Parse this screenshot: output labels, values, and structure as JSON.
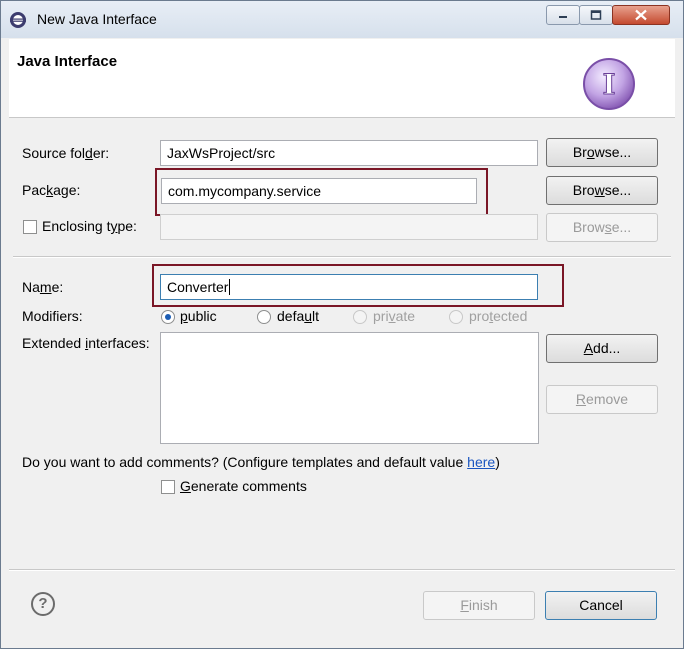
{
  "window": {
    "title": "New Java Interface",
    "minimize_icon": "minimize-icon",
    "maximize_icon": "maximize-icon",
    "close_icon": "close-icon"
  },
  "header": {
    "title": "Java Interface",
    "logo_icon": "interface-I-icon",
    "logo_letter": "I"
  },
  "form": {
    "source_folder": {
      "label": "Source folder:",
      "value": "JaxWsProject/src",
      "button": "Browse..."
    },
    "package": {
      "label": "Package:",
      "value": "com.mycompany.service",
      "button": "Browse..."
    },
    "enclosing": {
      "label": "Enclosing type:",
      "value": "",
      "button": "Browse...",
      "checked": false
    },
    "name": {
      "label": "Name:",
      "value": "Converter"
    },
    "modifiers": {
      "label": "Modifiers:",
      "options": [
        {
          "label": "public",
          "selected": true,
          "enabled": true
        },
        {
          "label": "default",
          "selected": false,
          "enabled": true
        },
        {
          "label": "private",
          "selected": false,
          "enabled": false
        },
        {
          "label": "protected",
          "selected": false,
          "enabled": false
        }
      ]
    },
    "extended": {
      "label": "Extended interfaces:",
      "add": "Add...",
      "remove": "Remove"
    },
    "comments": {
      "prompt": "Do you want to add comments? (Configure templates and default value ",
      "link": "here",
      "suffix": ")",
      "generate_label": "Generate comments",
      "generate_checked": false
    }
  },
  "footer": {
    "help_icon": "help-icon",
    "help_glyph": "?",
    "finish": "Finish",
    "cancel": "Cancel"
  },
  "colors": {
    "highlight": "#7a1626",
    "link": "#1a55c0",
    "logo": "#8b5fb8"
  }
}
